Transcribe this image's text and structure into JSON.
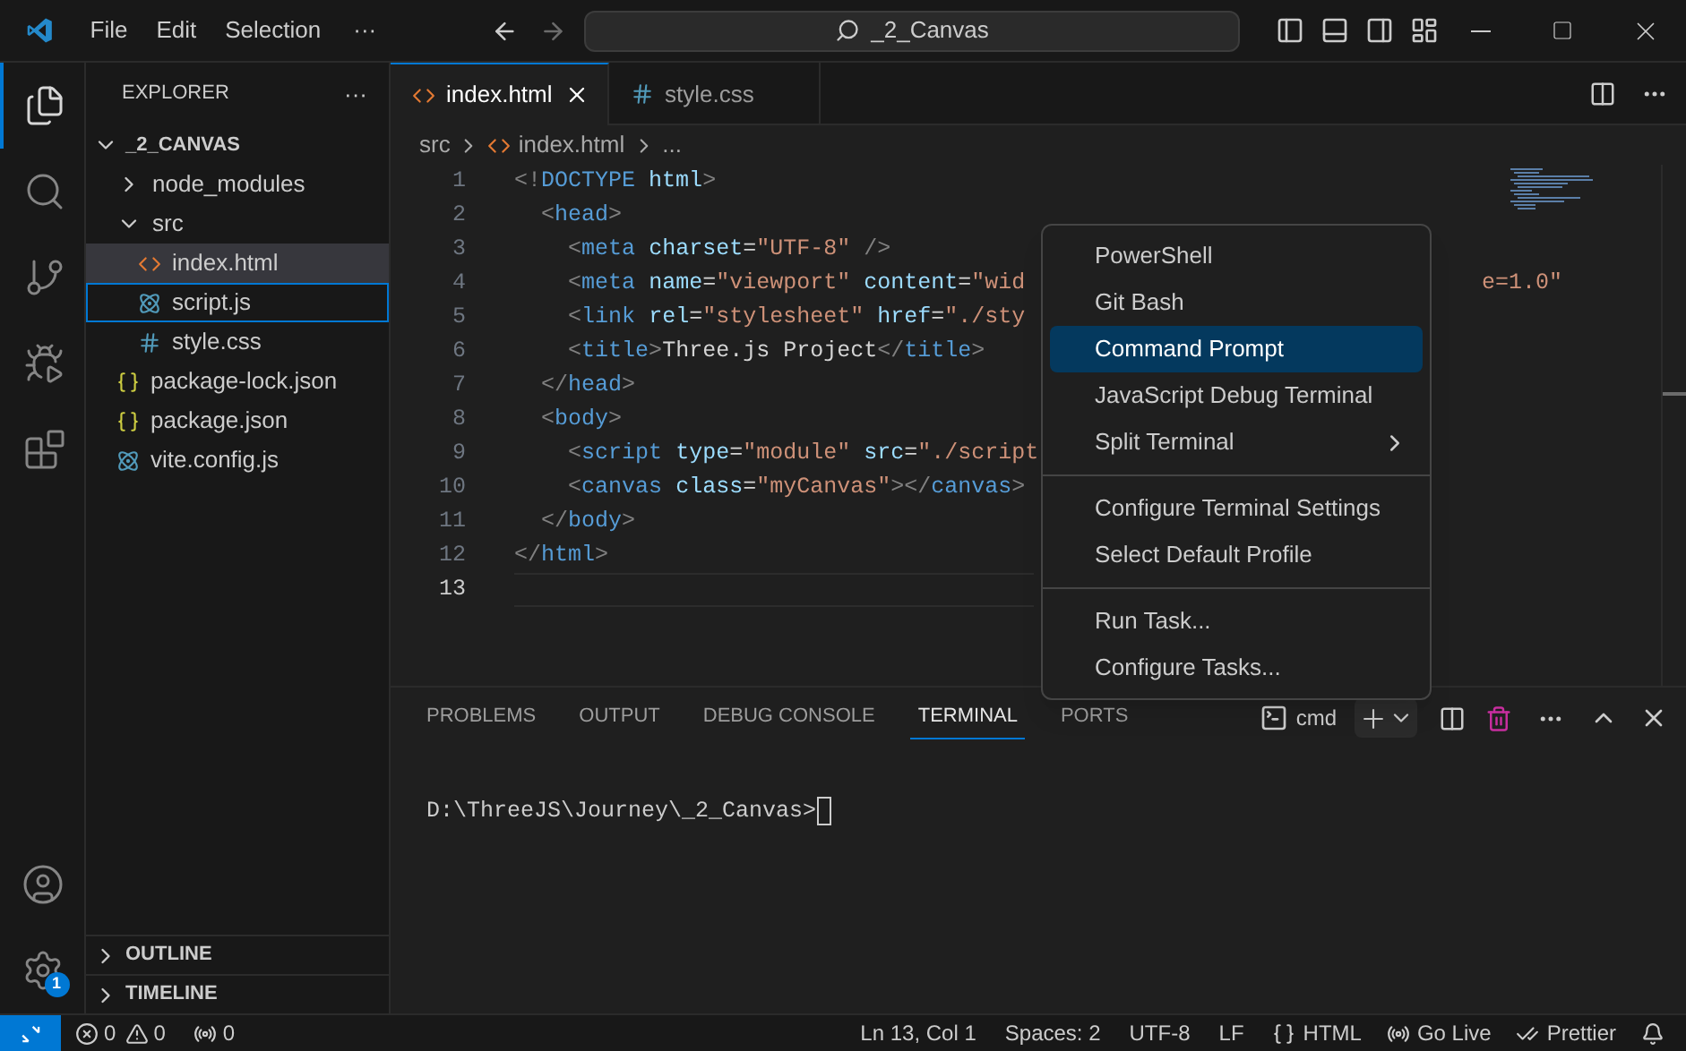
{
  "title_bar": {
    "menus": [
      "File",
      "Edit",
      "Selection"
    ],
    "more": "···",
    "search": "_2_Canvas"
  },
  "activity_bar": {
    "items": [
      {
        "kind": "files",
        "selected": true
      },
      {
        "kind": "search",
        "selected": false
      },
      {
        "kind": "source-control",
        "selected": false
      },
      {
        "kind": "run-debug",
        "selected": false
      },
      {
        "kind": "extensions",
        "selected": false
      }
    ],
    "settings_badge": "1"
  },
  "sidebar": {
    "title": "EXPLORER",
    "more": "···",
    "root": {
      "label": "_2_CANVAS",
      "expanded": true
    },
    "tree": [
      {
        "label": "node_modules",
        "kind": "folder",
        "expanded": false,
        "selected": false,
        "focused": false
      },
      {
        "label": "src",
        "kind": "folder",
        "expanded": true,
        "selected": false,
        "focused": false,
        "children": [
          {
            "label": "index.html",
            "kind": "html",
            "selected": true,
            "focused": false
          },
          {
            "label": "script.js",
            "kind": "react",
            "selected": false,
            "focused": true
          },
          {
            "label": "style.css",
            "kind": "css",
            "selected": false,
            "focused": false
          }
        ]
      },
      {
        "label": "package-lock.json",
        "kind": "json",
        "selected": false,
        "focused": false
      },
      {
        "label": "package.json",
        "kind": "json",
        "selected": false,
        "focused": false
      },
      {
        "label": "vite.config.js",
        "kind": "react",
        "selected": false,
        "focused": false
      }
    ],
    "sections": [
      {
        "label": "OUTLINE",
        "expanded": false
      },
      {
        "label": "TIMELINE",
        "expanded": false
      }
    ]
  },
  "editor": {
    "tabs": [
      {
        "label": "index.html",
        "kind": "html",
        "selected": true
      },
      {
        "label": "style.css",
        "kind": "css",
        "selected": false
      }
    ],
    "breadcrumbs": [
      "src",
      "index.html",
      "..."
    ],
    "lines": [
      {
        "n": "1",
        "code": "<!DOCTYPE html>",
        "current": false
      },
      {
        "n": "2",
        "code": "  <head>",
        "current": false
      },
      {
        "n": "3",
        "code": "    <meta charset=\"UTF-8\" />",
        "current": false
      },
      {
        "n": "4",
        "code": "    <meta name=\"viewport\" content=\"wid",
        "right": "e=1.0\"",
        "current": false
      },
      {
        "n": "5",
        "code": "    <link rel=\"stylesheet\" href=\"./sty",
        "current": false
      },
      {
        "n": "6",
        "code": "    <title>Three.js Project</title>",
        "current": false
      },
      {
        "n": "7",
        "code": "  </head>",
        "current": false
      },
      {
        "n": "8",
        "code": "  <body>",
        "current": false
      },
      {
        "n": "9",
        "code": "    <script type=\"module\" src=\"./script",
        "current": false
      },
      {
        "n": "10",
        "code": "    <canvas class=\"myCanvas\"></canvas>",
        "current": false
      },
      {
        "n": "11",
        "code": "  </body>",
        "current": false
      },
      {
        "n": "12",
        "code": "</html>",
        "current": false
      },
      {
        "n": "13",
        "current": true
      }
    ]
  },
  "menu": {
    "groups": [
      [
        {
          "label": "PowerShell",
          "kind": "item",
          "selected": false
        },
        {
          "label": "Git Bash",
          "kind": "item",
          "selected": false
        },
        {
          "label": "Command Prompt",
          "kind": "item",
          "selected": true
        },
        {
          "label": "JavaScript Debug Terminal",
          "kind": "item",
          "selected": false
        },
        {
          "label": "Split Terminal",
          "kind": "submenu",
          "selected": false
        }
      ],
      [
        {
          "label": "Configure Terminal Settings",
          "kind": "item",
          "selected": false
        },
        {
          "label": "Select Default Profile",
          "kind": "item",
          "selected": false
        }
      ],
      [
        {
          "label": "Run Task...",
          "kind": "item",
          "selected": false
        },
        {
          "label": "Configure Tasks...",
          "kind": "item",
          "selected": false
        }
      ]
    ]
  },
  "panel": {
    "tabs": [
      {
        "label": "PROBLEMS",
        "selected": false
      },
      {
        "label": "OUTPUT",
        "selected": false
      },
      {
        "label": "DEBUG CONSOLE",
        "selected": false
      },
      {
        "label": "TERMINAL",
        "selected": true
      },
      {
        "label": "PORTS",
        "selected": false
      }
    ],
    "terminal_name": "cmd",
    "prompt": "D:\\ThreeJS\\Journey\\_2_Canvas>"
  },
  "status_bar": {
    "errors": "0",
    "warnings": "0",
    "ports": "0",
    "right": [
      {
        "kind": "text",
        "label": "Ln 13, Col 1"
      },
      {
        "kind": "text",
        "label": "Spaces: 2"
      },
      {
        "kind": "text",
        "label": "UTF-8"
      },
      {
        "kind": "text",
        "label": "LF"
      },
      {
        "kind": "language",
        "label": "HTML"
      },
      {
        "kind": "live",
        "label": "Go Live"
      },
      {
        "kind": "prettier",
        "label": "Prettier"
      },
      {
        "kind": "bell"
      }
    ]
  }
}
